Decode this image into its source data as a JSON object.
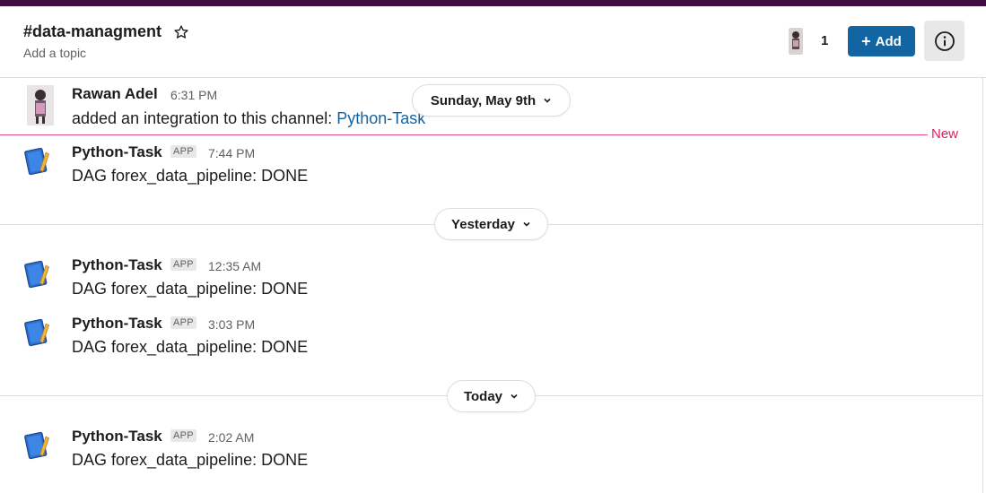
{
  "header": {
    "channel_name": "#data-managment",
    "topic_placeholder": "Add a topic",
    "member_count": "1",
    "add_label": "Add",
    "add_plus": "+"
  },
  "dividers": [
    {
      "label": "Sunday, May 9th"
    },
    {
      "label": "Yesterday"
    },
    {
      "label": "Today"
    }
  ],
  "new_label": "New",
  "messages": [
    {
      "author": "Rawan Adel",
      "time": "6:31 PM",
      "text_prefix": "added an integration to this channel: ",
      "text_link": "Python-Task"
    },
    {
      "author": "Python-Task",
      "badge": "APP",
      "time": "7:44 PM",
      "text": "DAG forex_data_pipeline: DONE"
    },
    {
      "author": "Python-Task",
      "badge": "APP",
      "time": "12:35 AM",
      "text": "DAG forex_data_pipeline: DONE"
    },
    {
      "author": "Python-Task",
      "badge": "APP",
      "time": "3:03 PM",
      "text": "DAG forex_data_pipeline: DONE"
    },
    {
      "author": "Python-Task",
      "badge": "APP",
      "time": "2:02 AM",
      "text": "DAG forex_data_pipeline: DONE"
    }
  ],
  "colors": {
    "workspace_bar": "#3f0e40",
    "add_button": "#1264a3",
    "link": "#1264a3",
    "new_marker": "#e01e5a"
  },
  "icons": [
    "star-icon",
    "info-icon",
    "chevron-down-icon",
    "notebook-icon",
    "user-avatar"
  ]
}
